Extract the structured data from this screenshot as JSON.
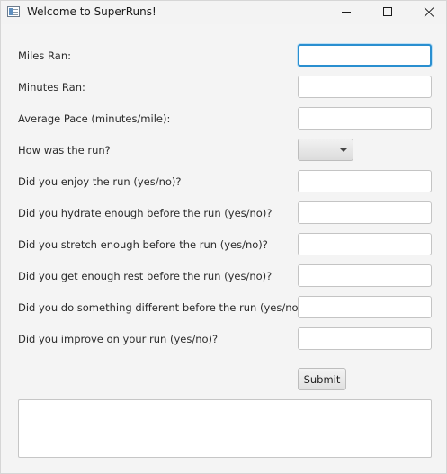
{
  "window": {
    "title": "Welcome to SuperRuns!"
  },
  "form": {
    "fields": [
      {
        "label": "Miles Ran:",
        "value": ""
      },
      {
        "label": "Minutes Ran:",
        "value": ""
      },
      {
        "label": "Average Pace (minutes/mile):",
        "value": ""
      },
      {
        "label": "How was the run?",
        "value": ""
      },
      {
        "label": "Did you enjoy the run (yes/no)?",
        "value": ""
      },
      {
        "label": "Did you hydrate enough before the run (yes/no)?",
        "value": ""
      },
      {
        "label": "Did you stretch enough before the run (yes/no)?",
        "value": ""
      },
      {
        "label": "Did you get enough rest before the run (yes/no)?",
        "value": ""
      },
      {
        "label": "Did you do something different before the run (yes/no)?",
        "value": ""
      },
      {
        "label": "Did you improve on your run (yes/no)?",
        "value": ""
      }
    ],
    "run_rating": {
      "selected": ""
    },
    "submit_label": "Submit",
    "output_text": ""
  },
  "colors": {
    "focus": "#2a8fd0",
    "background": "#f4f4f4"
  }
}
